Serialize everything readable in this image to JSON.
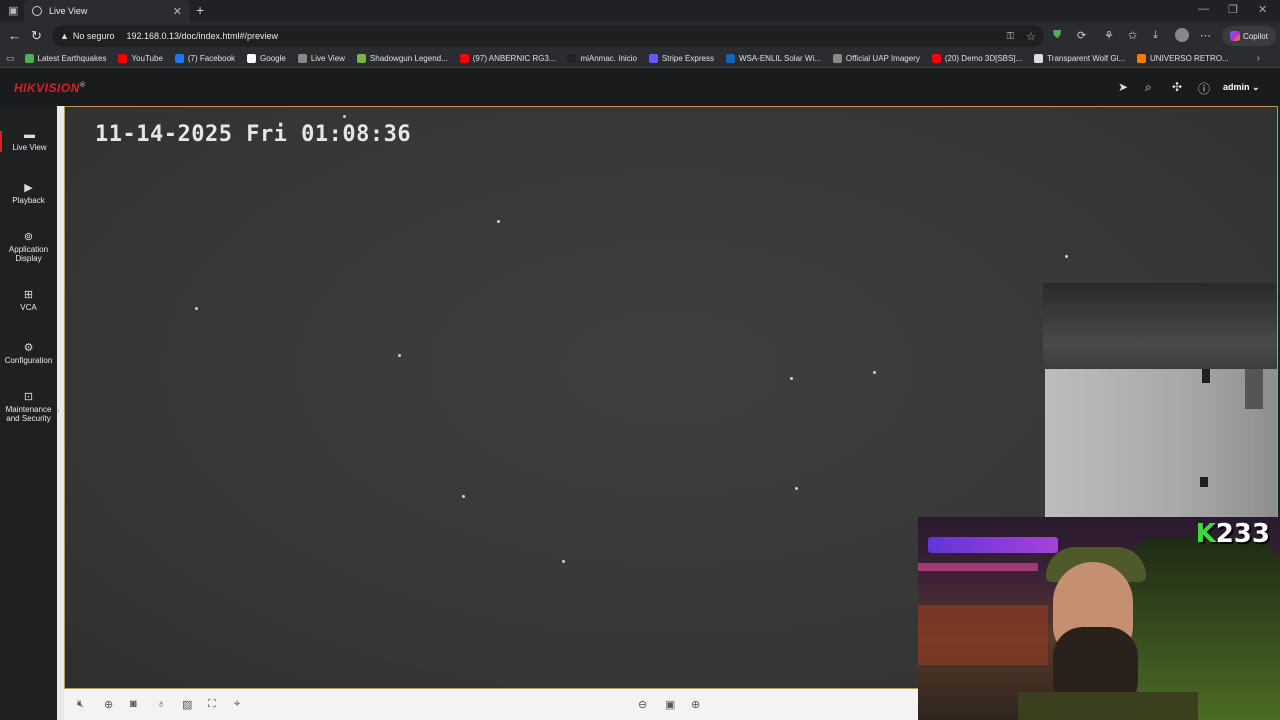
{
  "browser": {
    "tab_title": "Live View",
    "security_label": "No seguro",
    "url": "192.168.0.13/doc/index.html#/preview",
    "copilot_label": "Copilot",
    "bookmarks": [
      {
        "label": "Latest Earthquakes",
        "icon": "earthquake-icon",
        "color": "#4caf50"
      },
      {
        "label": "YouTube",
        "icon": "youtube-icon",
        "color": "#ff0000"
      },
      {
        "label": "(7) Facebook",
        "icon": "facebook-icon",
        "color": "#1877f2"
      },
      {
        "label": "Google",
        "icon": "google-icon",
        "color": "#ffffff"
      },
      {
        "label": "Live View",
        "icon": "globe-icon",
        "color": "#888888"
      },
      {
        "label": "Shadowgun Legend...",
        "icon": "android-icon",
        "color": "#7cb342"
      },
      {
        "label": "(97) ANBERNIC RG3...",
        "icon": "youtube-icon",
        "color": "#ff0000"
      },
      {
        "label": "miAnmac. Inicio",
        "icon": "r-icon",
        "color": "#222222"
      },
      {
        "label": "Stripe Express",
        "icon": "stripe-icon",
        "color": "#635bff"
      },
      {
        "label": "WSA-ENLIL Solar Wi...",
        "icon": "noaa-icon",
        "color": "#1565c0"
      },
      {
        "label": "Official UAP Imagery",
        "icon": "globe-icon",
        "color": "#888888"
      },
      {
        "label": "(20) Demo 3D[SBS]...",
        "icon": "youtube-icon",
        "color": "#ff0000"
      },
      {
        "label": "Transparent Wolf Gl...",
        "icon": "page-icon",
        "color": "#dddddd"
      },
      {
        "label": "UNIVERSO RETRO...",
        "icon": "blogger-icon",
        "color": "#f57c00"
      }
    ]
  },
  "app": {
    "brand": "HIKVISION",
    "brand_mark": "®",
    "user": "admin",
    "nav": [
      {
        "label": "Live View",
        "icon": "live-view-icon"
      },
      {
        "label": "Playback",
        "icon": "playback-icon"
      },
      {
        "label": "Application Display",
        "icon": "application-icon"
      },
      {
        "label": "VCA",
        "icon": "vca-icon"
      },
      {
        "label": "Configuration",
        "icon": "gear-icon"
      },
      {
        "label": "Maintenance and Security",
        "icon": "maintenance-icon"
      }
    ],
    "osd_timestamp": "11-14-2025 Fri 01:08:36"
  },
  "overlay": {
    "badge_letter": "K",
    "badge_count": "233"
  }
}
